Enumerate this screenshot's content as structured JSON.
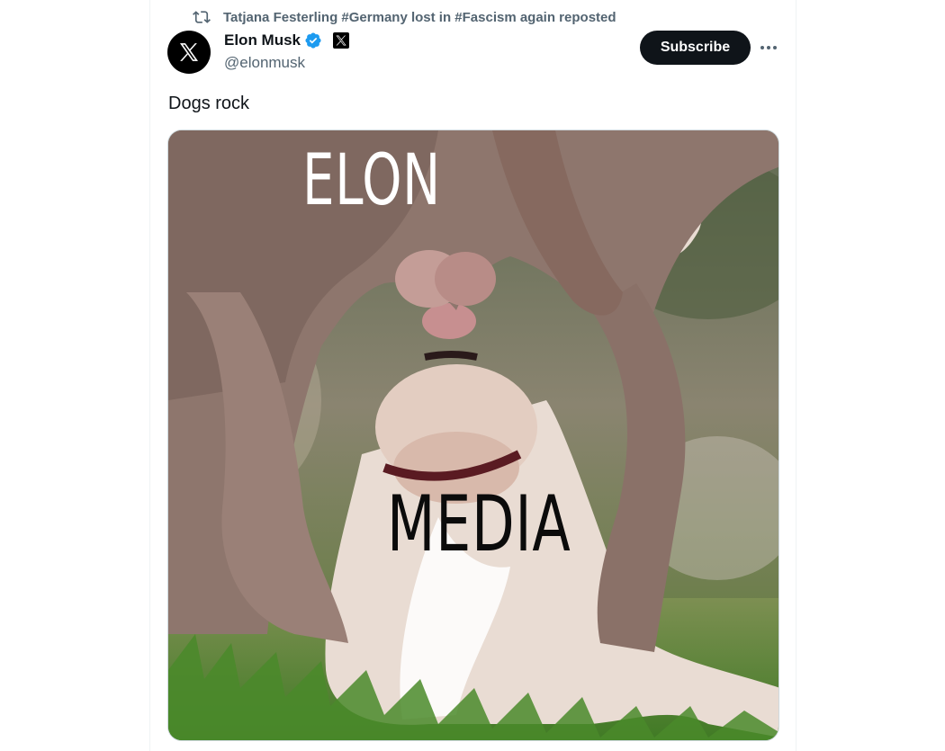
{
  "repost": {
    "text": "Tatjana Festerling #Germany lost in #Fascism again reposted"
  },
  "author": {
    "name": "Elon Musk",
    "handle": "@elonmusk"
  },
  "actions": {
    "subscribe_label": "Subscribe"
  },
  "tweet": {
    "text": "Dogs rock"
  },
  "media": {
    "caption_top": "ELON",
    "caption_bottom": "MEDIA"
  },
  "icons": {
    "repost": "repost-icon",
    "avatar": "x-logo-icon",
    "verified": "verified-badge-icon",
    "affiliation": "x-affiliation-icon",
    "more": "more-dots-icon"
  },
  "colors": {
    "text_primary": "#0f1419",
    "text_secondary": "#536471",
    "verified_blue": "#1d9bf0",
    "subscribe_bg": "#0f1419"
  }
}
